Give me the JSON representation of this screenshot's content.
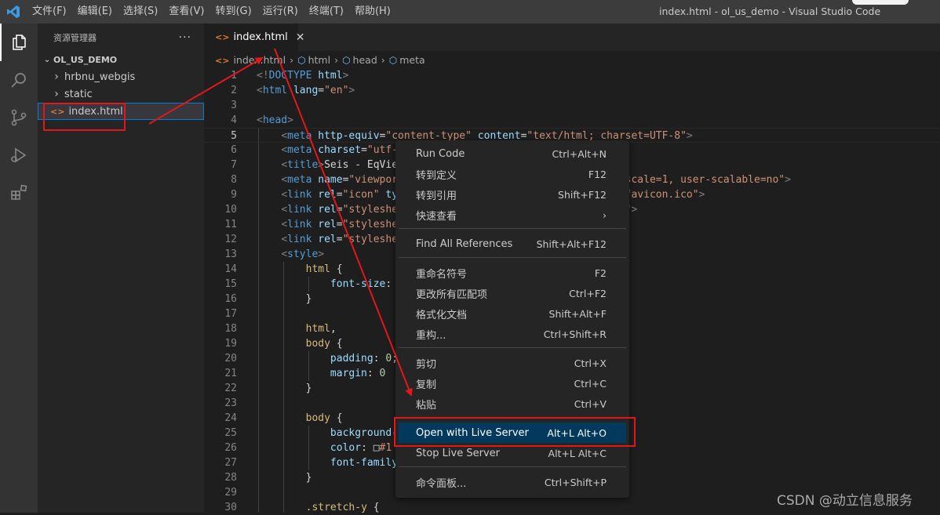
{
  "titlebar": {
    "menu": [
      "文件(F)",
      "编辑(E)",
      "选择(S)",
      "查看(V)",
      "转到(G)",
      "运行(R)",
      "终端(T)",
      "帮助(H)"
    ],
    "window_title": "index.html - ol_us_demo - Visual Studio Code"
  },
  "activitybar": {
    "items": [
      "explorer-icon",
      "search-icon",
      "source-control-icon",
      "run-debug-icon",
      "extensions-icon"
    ]
  },
  "sidebar": {
    "title": "资源管理器",
    "more": "···",
    "root": "OL_US_DEMO",
    "items": [
      {
        "label": "hrbnu_webgis",
        "kind": "folder"
      },
      {
        "label": "static",
        "kind": "folder"
      },
      {
        "label": "index.html",
        "kind": "file",
        "selected": true
      }
    ]
  },
  "tab": {
    "label": "index.html",
    "close": "✕"
  },
  "breadcrumb": [
    "index.html",
    "html",
    "head",
    "meta"
  ],
  "editor": {
    "current_line": 5,
    "lines": [
      {
        "n": "1",
        "html": "<span class='p'>&lt;!</span><span class='t'>DOCTYPE</span> <span class='a'>html</span><span class='p'>&gt;</span>"
      },
      {
        "n": "2",
        "html": "<span class='p'>&lt;</span><span class='t'>html</span> <span class='a'>lang</span><span class='x'>=</span><span class='s'>\"en\"</span><span class='p'>&gt;</span>"
      },
      {
        "n": "3",
        "html": ""
      },
      {
        "n": "4",
        "html": "<span class='p'>&lt;</span><span class='t'>head</span><span class='p'>&gt;</span>"
      },
      {
        "n": "5",
        "html": "    <span class='p'>&lt;</span><span class='t'>meta</span> <span class='a'>http-equiv</span><span class='x'>=</span><span class='s'>\"content-type\"</span> <span class='a'>content</span><span class='x'>=</span><span class='s'>\"text/html; charset=UTF-8\"</span><span class='p'>&gt;</span>"
      },
      {
        "n": "6",
        "html": "    <span class='p'>&lt;</span><span class='t'>meta</span> <span class='a'>charset</span><span class='x'>=</span><span class='s'>\"utf-</span>"
      },
      {
        "n": "7",
        "html": "    <span class='p'>&lt;</span><span class='t'>title</span><span class='p'>&gt;</span><span class='x'>Seis - EqVie</span>"
      },
      {
        "n": "8",
        "html": "    <span class='p'>&lt;</span><span class='t'>meta</span> <span class='a'>name</span><span class='x'>=</span><span class='s'>\"viewpor</span>                                   <span class='s'>l-scale=1, user-scalable=no\"</span><span class='p'>&gt;</span>"
      },
      {
        "n": "9",
        "html": "    <span class='p'>&lt;</span><span class='t'>link</span> <span class='a'>rel</span><span class='x'>=</span><span class='s'>\"icon\"</span> <span class='a'>ty</span>                                   <span class='s'>s/favicon.ico\"</span><span class='p'>&gt;</span>"
      },
      {
        "n": "10",
        "html": "    <span class='p'>&lt;</span><span class='t'>link</span> <span class='a'>rel</span><span class='x'>=</span><span class='s'>\"styleshe</span>                                   <span class='s'>ss\"</span><span class='p'>&gt;</span>"
      },
      {
        "n": "11",
        "html": "    <span class='p'>&lt;</span><span class='t'>link</span> <span class='a'>rel</span><span class='x'>=</span><span class='s'>\"styleshe</span>"
      },
      {
        "n": "12",
        "html": "    <span class='p'>&lt;</span><span class='t'>link</span> <span class='a'>rel</span><span class='x'>=</span><span class='s'>\"styleshe</span>"
      },
      {
        "n": "13",
        "html": "    <span class='p'>&lt;</span><span class='t'>style</span><span class='p'>&gt;</span>"
      },
      {
        "n": "14",
        "html": "        <span class='c'>html</span> <span class='x'>{</span>"
      },
      {
        "n": "15",
        "html": "            <span class='a'>font-size</span><span class='x'>:</span>"
      },
      {
        "n": "16",
        "html": "        <span class='x'>}</span>"
      },
      {
        "n": "17",
        "html": ""
      },
      {
        "n": "18",
        "html": "        <span class='c'>html</span><span class='x'>,</span>"
      },
      {
        "n": "19",
        "html": "        <span class='c'>body</span> <span class='x'>{</span>"
      },
      {
        "n": "20",
        "html": "            <span class='a'>padding</span><span class='x'>: </span><span class='n'>0</span><span class='x'>;</span>"
      },
      {
        "n": "21",
        "html": "            <span class='a'>margin</span><span class='x'>: </span><span class='n'>0</span>"
      },
      {
        "n": "22",
        "html": "        <span class='x'>}</span>"
      },
      {
        "n": "23",
        "html": ""
      },
      {
        "n": "24",
        "html": "        <span class='c'>body</span> <span class='x'>{</span>"
      },
      {
        "n": "25",
        "html": "            <span class='a'>background-</span>"
      },
      {
        "n": "26",
        "html": "            <span class='a'>color</span><span class='x'>: </span><span class='x'>□</span><span class='s'>#1</span>"
      },
      {
        "n": "27",
        "html": "            <span class='a'>font-family</span>"
      },
      {
        "n": "28",
        "html": "        <span class='x'>}</span>"
      },
      {
        "n": "29",
        "html": ""
      },
      {
        "n": "30",
        "html": "        <span class='c'>.stretch-y</span> <span class='x'>{</span>"
      }
    ]
  },
  "context_menu": {
    "items": [
      {
        "label": "Run Code",
        "key": "Ctrl+Alt+N"
      },
      {
        "label": "转到定义",
        "key": "F12"
      },
      {
        "label": "转到引用",
        "key": "Shift+F12"
      },
      {
        "label": "快速查看",
        "key": "›"
      },
      {
        "sep": true
      },
      {
        "label": "Find All References",
        "key": "Shift+Alt+F12"
      },
      {
        "sep": true
      },
      {
        "label": "重命名符号",
        "key": "F2"
      },
      {
        "label": "更改所有匹配项",
        "key": "Ctrl+F2"
      },
      {
        "label": "格式化文档",
        "key": "Shift+Alt+F"
      },
      {
        "label": "重构...",
        "key": "Ctrl+Shift+R"
      },
      {
        "sep": true
      },
      {
        "label": "剪切",
        "key": "Ctrl+X"
      },
      {
        "label": "复制",
        "key": "Ctrl+C"
      },
      {
        "label": "粘贴",
        "key": "Ctrl+V"
      },
      {
        "sep": true
      },
      {
        "label": "Open with Live Server",
        "key": "Alt+L Alt+O",
        "highlighted": true
      },
      {
        "label": "Stop Live Server",
        "key": "Alt+L Alt+C"
      },
      {
        "sep": true
      },
      {
        "label": "命令面板...",
        "key": "Ctrl+Shift+P"
      }
    ]
  },
  "watermark": "CSDN @动立信息服务",
  "colors": {
    "accent": "#007acc",
    "annotation": "#e0181a",
    "menu_highlight": "#04395e"
  }
}
